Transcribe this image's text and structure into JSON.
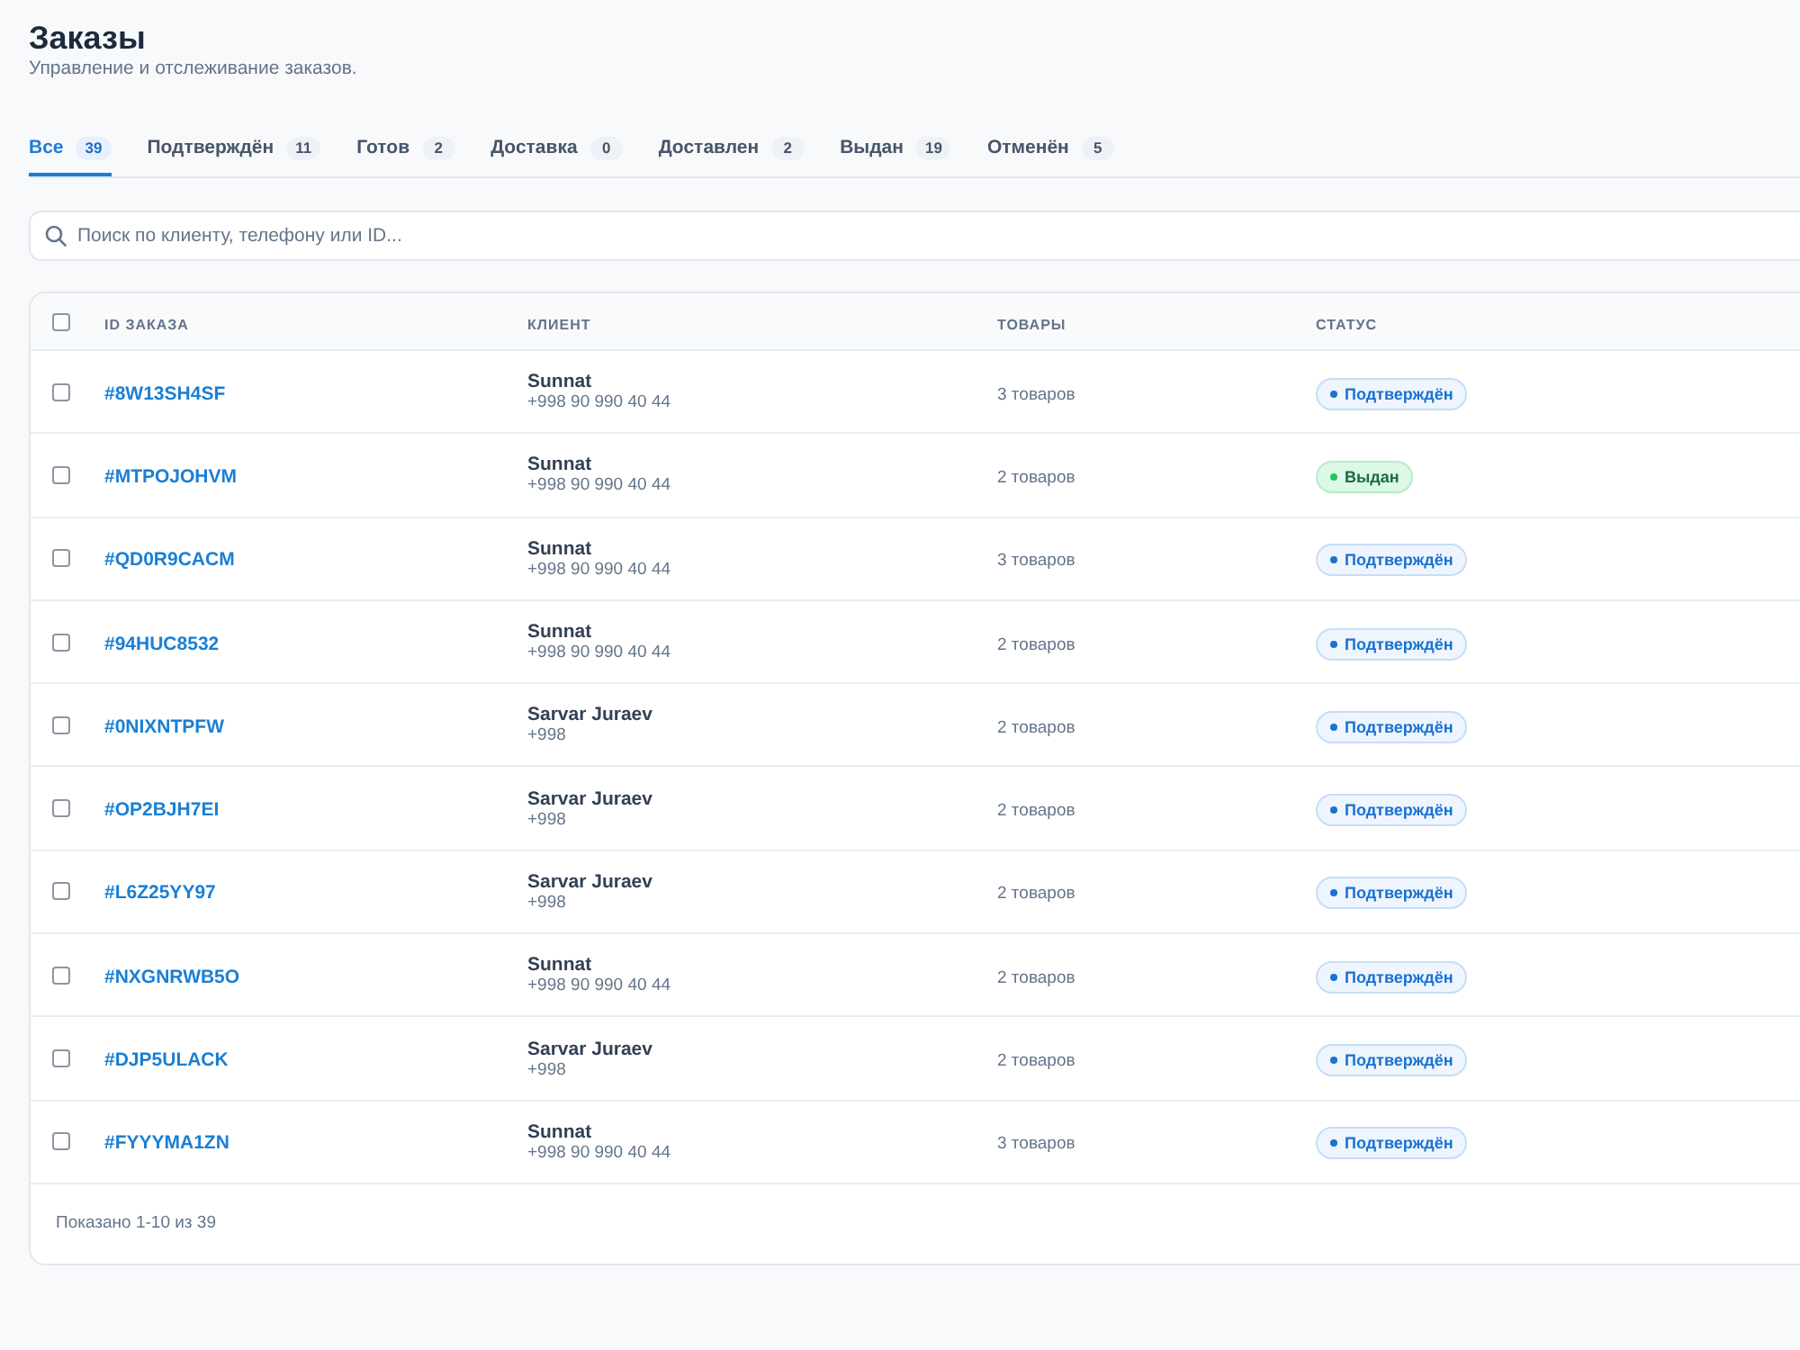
{
  "page": {
    "title": "Заказы",
    "subtitle": "Управление и отслеживание заказов."
  },
  "tabs": [
    {
      "label": "Все",
      "count": "39",
      "selected": true
    },
    {
      "label": "Подтверждён",
      "count": "11",
      "selected": false
    },
    {
      "label": "Готов",
      "count": "2",
      "selected": false
    },
    {
      "label": "Доставка",
      "count": "0",
      "selected": false
    },
    {
      "label": "Доставлен",
      "count": "2",
      "selected": false
    },
    {
      "label": "Выдан",
      "count": "19",
      "selected": false
    },
    {
      "label": "Отменён",
      "count": "5",
      "selected": false
    }
  ],
  "search": {
    "placeholder": "Поиск по клиенту, телефону или ID..."
  },
  "table": {
    "select_all": {
      "checked": false
    },
    "columns": [
      "ID ЗАКАЗА",
      "КЛИЕНТ",
      "ТОВАРЫ",
      "СТАТУС"
    ],
    "rows": [
      {
        "checked": false,
        "id": "#8W13SH4SF",
        "client": "Sunnat",
        "phone": "+998 90 990 40 44",
        "items": "3 товаров",
        "status": {
          "label": "Подтверждён",
          "kind": "confirmed"
        }
      },
      {
        "checked": false,
        "id": "#MTPOJOHVM",
        "client": "Sunnat",
        "phone": "+998 90 990 40 44",
        "items": "2 товаров",
        "status": {
          "label": "Выдан",
          "kind": "issued"
        }
      },
      {
        "checked": false,
        "id": "#QD0R9CACM",
        "client": "Sunnat",
        "phone": "+998 90 990 40 44",
        "items": "3 товаров",
        "status": {
          "label": "Подтверждён",
          "kind": "confirmed"
        }
      },
      {
        "checked": false,
        "id": "#94HUC8532",
        "client": "Sunnat",
        "phone": "+998 90 990 40 44",
        "items": "2 товаров",
        "status": {
          "label": "Подтверждён",
          "kind": "confirmed"
        }
      },
      {
        "checked": false,
        "id": "#0NIXNTPFW",
        "client": "Sarvar Juraev",
        "phone": "+998",
        "items": "2 товаров",
        "status": {
          "label": "Подтверждён",
          "kind": "confirmed"
        }
      },
      {
        "checked": false,
        "id": "#OP2BJH7EI",
        "client": "Sarvar Juraev",
        "phone": "+998",
        "items": "2 товаров",
        "status": {
          "label": "Подтверждён",
          "kind": "confirmed"
        }
      },
      {
        "checked": false,
        "id": "#L6Z25YY97",
        "client": "Sarvar Juraev",
        "phone": "+998",
        "items": "2 товаров",
        "status": {
          "label": "Подтверждён",
          "kind": "confirmed"
        }
      },
      {
        "checked": false,
        "id": "#NXGNRWB5O",
        "client": "Sunnat",
        "phone": "+998 90 990 40 44",
        "items": "2 товаров",
        "status": {
          "label": "Подтверждён",
          "kind": "confirmed"
        }
      },
      {
        "checked": false,
        "id": "#DJP5ULACK",
        "client": "Sarvar Juraev",
        "phone": "+998",
        "items": "2 товаров",
        "status": {
          "label": "Подтверждён",
          "kind": "confirmed"
        }
      },
      {
        "checked": false,
        "id": "#FYYYMA1ZN",
        "client": "Sunnat",
        "phone": "+998 90 990 40 44",
        "items": "3 товаров",
        "status": {
          "label": "Подтверждён",
          "kind": "confirmed"
        }
      }
    ],
    "footer": {
      "summary": "Показано 1-10 из 39"
    }
  }
}
